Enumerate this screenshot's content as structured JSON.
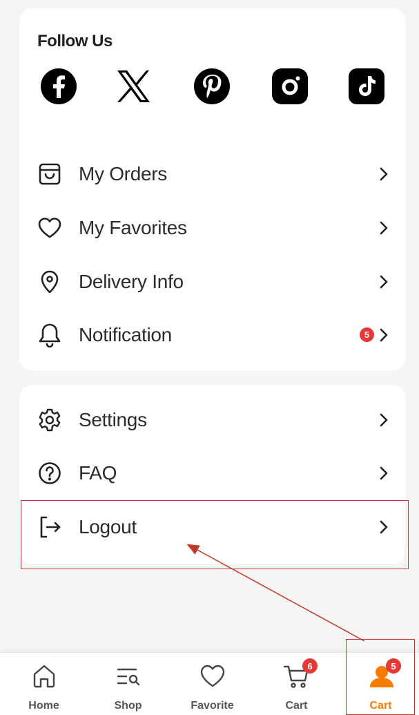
{
  "follow": {
    "title": "Follow Us",
    "networks": [
      "facebook-icon",
      "x-icon",
      "pinterest-icon",
      "instagram-icon",
      "tiktok-icon"
    ]
  },
  "menu_main": [
    {
      "label": "My Orders",
      "icon": "shopping-bag-icon"
    },
    {
      "label": "My Favorites",
      "icon": "heart-icon"
    },
    {
      "label": "Delivery Info",
      "icon": "location-pin-icon"
    },
    {
      "label": "Notification",
      "icon": "bell-icon",
      "badge": "5"
    }
  ],
  "menu_secondary": [
    {
      "label": "Settings",
      "icon": "gear-icon"
    },
    {
      "label": "FAQ",
      "icon": "question-icon"
    },
    {
      "label": "Logout",
      "icon": "logout-icon"
    }
  ],
  "bottom_nav": [
    {
      "label": "Home",
      "icon": "home-icon"
    },
    {
      "label": "Shop",
      "icon": "shop-search-icon"
    },
    {
      "label": "Favorite",
      "icon": "heart-icon"
    },
    {
      "label": "Cart",
      "icon": "cart-icon",
      "badge": "6"
    },
    {
      "label": "Cart",
      "icon": "user-icon",
      "badge": "5",
      "active": true
    }
  ],
  "colors": {
    "accent": "#f57c00",
    "badge": "#e53935",
    "annotation": "#c0392b"
  }
}
